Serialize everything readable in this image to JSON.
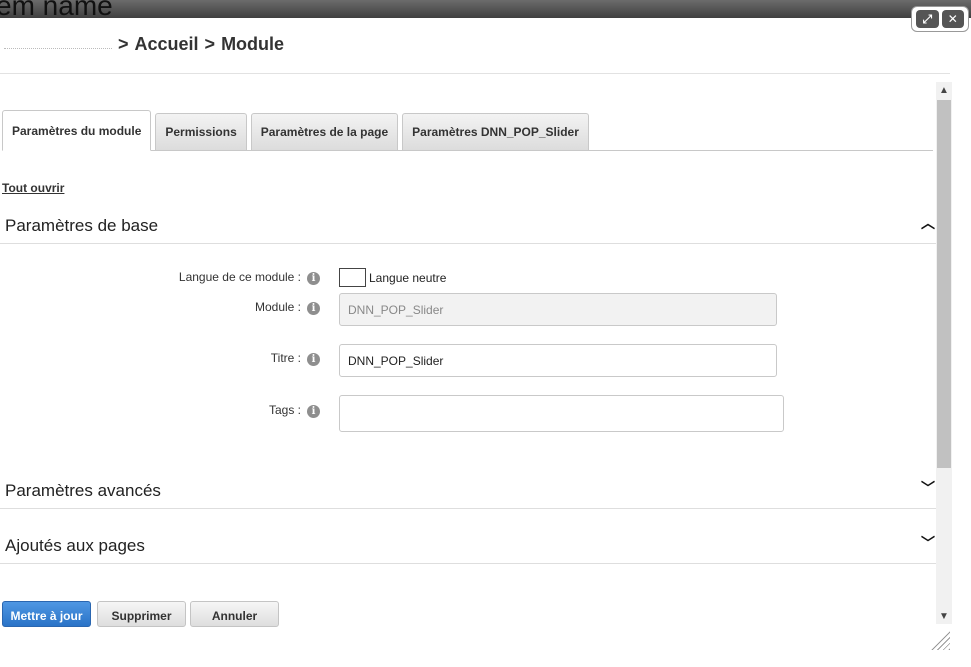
{
  "backdrop": {
    "text": "em name"
  },
  "window_controls": {
    "maximize_icon": "expand-arrows-icon",
    "close_icon": "close-icon"
  },
  "breadcrumb": {
    "separator": ">",
    "items": [
      "Accueil",
      "Module"
    ]
  },
  "tabs": [
    {
      "label": "Paramètres du module",
      "active": true
    },
    {
      "label": "Permissions",
      "active": false
    },
    {
      "label": "Paramètres de la page",
      "active": false
    },
    {
      "label": "Paramètres DNN_POP_Slider",
      "active": false
    }
  ],
  "expand_all": "Tout ouvrir",
  "sections": {
    "basic": {
      "title": "Paramètres de base",
      "expanded": true
    },
    "advanced": {
      "title": "Paramètres avancés",
      "expanded": false
    },
    "pages": {
      "title": "Ajoutés aux pages",
      "expanded": false
    }
  },
  "form": {
    "language": {
      "label": "Langue de ce module :",
      "checkbox_label": "Langue neutre",
      "checked": false
    },
    "module": {
      "label": "Module :",
      "value": "DNN_POP_Slider"
    },
    "title": {
      "label": "Titre :",
      "value": "DNN_POP_Slider"
    },
    "tags": {
      "label": "Tags :",
      "value": ""
    }
  },
  "buttons": {
    "update": "Mettre à jour",
    "delete": "Supprimer",
    "cancel": "Annuler"
  },
  "colors": {
    "primary": "#2a73c7",
    "tab_border": "#c8c8c8"
  }
}
